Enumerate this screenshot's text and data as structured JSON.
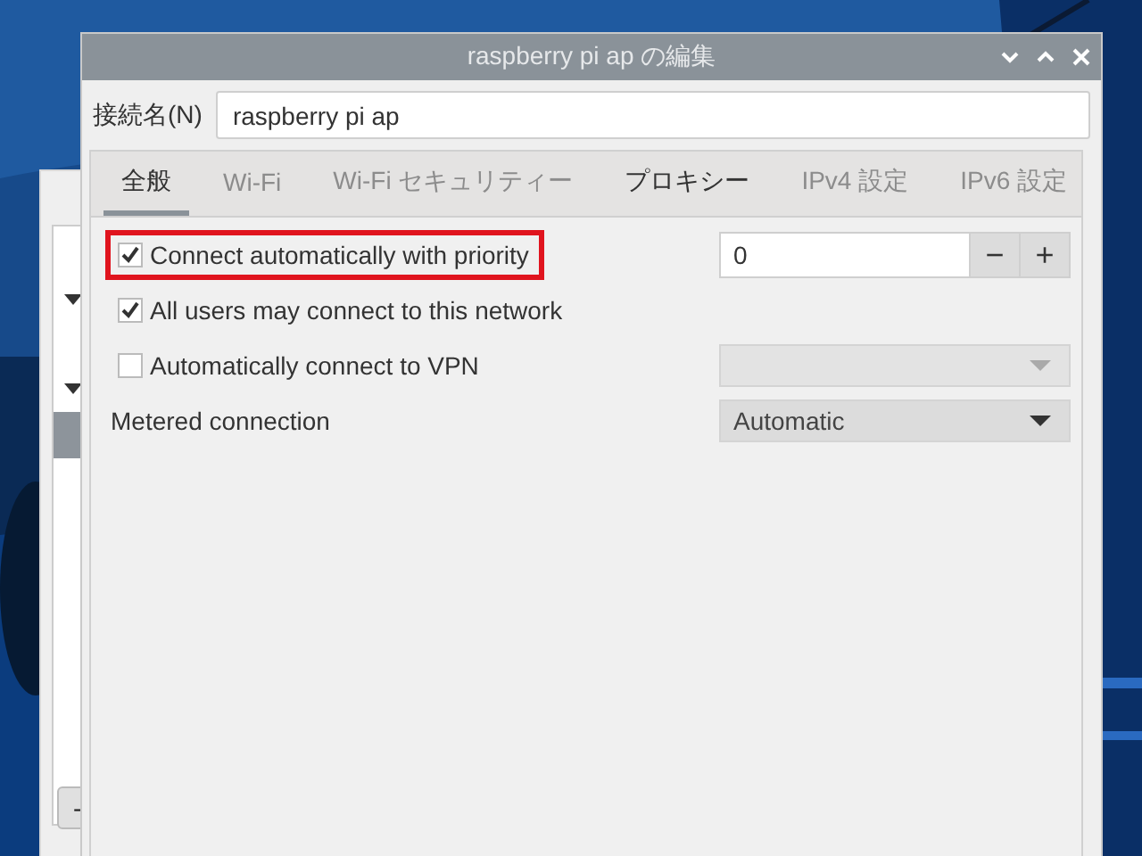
{
  "background_window": {
    "button": "-"
  },
  "window": {
    "title": "raspberry pi ap の編集"
  },
  "connection_name": {
    "label": "接続名(N)",
    "value": "raspberry pi ap"
  },
  "tabs": [
    {
      "label": "全般",
      "selected": true,
      "disabled": false
    },
    {
      "label": "Wi-Fi",
      "selected": false,
      "disabled": true
    },
    {
      "label": "Wi-Fi セキュリティー",
      "selected": false,
      "disabled": true
    },
    {
      "label": "プロキシー",
      "selected": false,
      "disabled": false
    },
    {
      "label": "IPv4 設定",
      "selected": false,
      "disabled": true
    },
    {
      "label": "IPv6 設定",
      "selected": false,
      "disabled": true
    }
  ],
  "options": [
    {
      "kind": "spin",
      "label": "Connect automatically with priority",
      "checked": true,
      "highlighted": true,
      "value": "0",
      "minus": "−",
      "plus": "+"
    },
    {
      "kind": "check",
      "label": "All users may connect to this network",
      "checked": true,
      "highlighted": false
    },
    {
      "kind": "combo",
      "label": "Automatically connect to VPN",
      "checked": false,
      "highlighted": false,
      "disabled": true
    },
    {
      "kind": "select",
      "label": "Metered connection",
      "value": "Automatic"
    }
  ]
}
